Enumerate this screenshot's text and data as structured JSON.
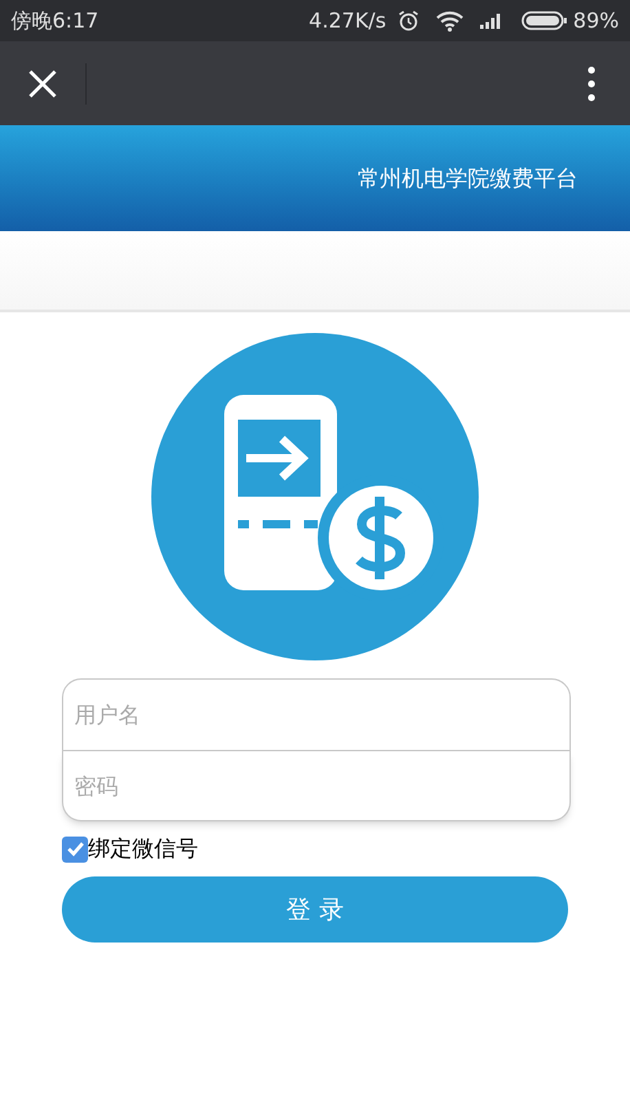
{
  "status_bar": {
    "time": "傍晚6:17",
    "speed": "4.27K/s",
    "battery": "89%"
  },
  "header": {
    "title": "常州机电学院缴费平台"
  },
  "form": {
    "username": {
      "placeholder": "用户名"
    },
    "password": {
      "placeholder": "密码"
    },
    "bind": {
      "label": "绑定微信号",
      "checked": true
    },
    "submit": "登 录"
  }
}
